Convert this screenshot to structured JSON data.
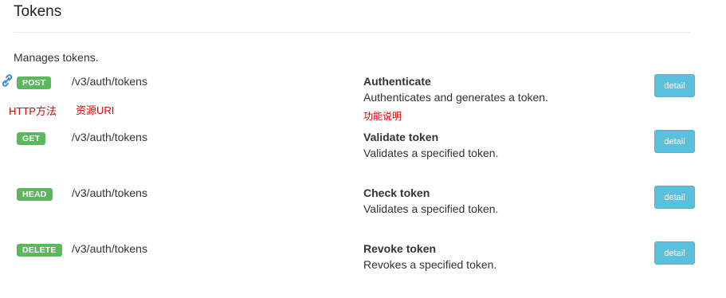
{
  "section": {
    "title": "Tokens",
    "description": "Manages tokens."
  },
  "annotations": {
    "method": "HTTP方法",
    "uri": "资源URI",
    "function": "功能说明"
  },
  "endpoints": [
    {
      "method": "POST",
      "path": "/v3/auth/tokens",
      "title": "Authenticate",
      "description": "Authenticates and generates a token.",
      "button": "detail"
    },
    {
      "method": "GET",
      "path": "/v3/auth/tokens",
      "title": "Validate token",
      "description": "Validates a specified token.",
      "button": "detail"
    },
    {
      "method": "HEAD",
      "path": "/v3/auth/tokens",
      "title": "Check token",
      "description": "Validates a specified token.",
      "button": "detail"
    },
    {
      "method": "DELETE",
      "path": "/v3/auth/tokens",
      "title": "Revoke token",
      "description": "Revokes a specified token.",
      "button": "detail"
    }
  ],
  "icons": {
    "anchor": "link-icon"
  },
  "colors": {
    "method_badge": "#5cb85c",
    "detail_button": "#5bc0de",
    "annotation": "#e00000"
  }
}
